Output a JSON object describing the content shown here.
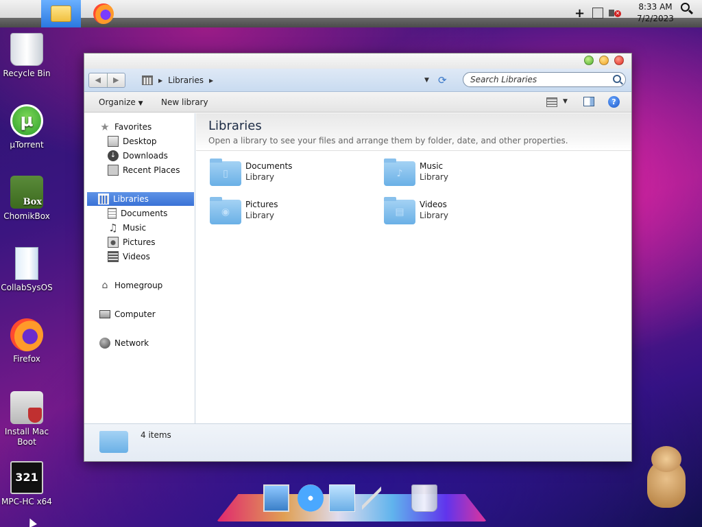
{
  "menubar": {
    "time": "8:33 AM",
    "date": "7/2/2023",
    "icons": [
      "apple-icon",
      "file-explorer-icon",
      "firefox-icon",
      "plus-icon",
      "network-icon",
      "volume-muted-icon",
      "search-icon"
    ]
  },
  "desktop": {
    "icons": [
      {
        "label": "Recycle Bin",
        "icon": "recycle-bin-icon"
      },
      {
        "label": "µTorrent",
        "icon": "utorrent-icon"
      },
      {
        "label": "ChomikBox",
        "icon": "chomikbox-icon"
      },
      {
        "label": "CollabSysOS",
        "icon": "collabsysos-icon"
      },
      {
        "label": "Firefox",
        "icon": "firefox-icon"
      },
      {
        "label": "Install Mac Boot",
        "icon": "install-mac-boot-icon"
      },
      {
        "label": "MPC-HC x64",
        "icon": "mpc-hc-icon"
      }
    ],
    "chomik_badge": "Box",
    "mpc_badge": "321"
  },
  "window": {
    "breadcrumb": "Libraries",
    "search_placeholder": "Search Libraries",
    "nav_back": "◀",
    "nav_forward": "▶",
    "toolbar": {
      "organize": "Organize",
      "new_library": "New library",
      "help": "?"
    },
    "sidebar": {
      "favorites": "Favorites",
      "favorites_items": [
        "Desktop",
        "Downloads",
        "Recent Places"
      ],
      "libraries": "Libraries",
      "libraries_items": [
        "Documents",
        "Music",
        "Pictures",
        "Videos"
      ],
      "homegroup": "Homegroup",
      "computer": "Computer",
      "network": "Network"
    },
    "main": {
      "title": "Libraries",
      "subtitle": "Open a library to see your files and arrange them by folder, date, and other properties.",
      "libraries": [
        {
          "name": "Documents",
          "kind": "Library",
          "glyph": "document-icon"
        },
        {
          "name": "Music",
          "kind": "Library",
          "glyph": "music-note-icon"
        },
        {
          "name": "Pictures",
          "kind": "Library",
          "glyph": "camera-icon"
        },
        {
          "name": "Videos",
          "kind": "Library",
          "glyph": "film-icon"
        }
      ]
    },
    "details": {
      "count": "4 items"
    }
  },
  "dock": {
    "items": [
      "preview-icon",
      "safari-icon",
      "mail-icon",
      "pen-icon",
      "trash-icon"
    ]
  },
  "colors": {
    "selection": "#3a72d6",
    "window_bg": "#ffffff",
    "folder": "#6ab0e6"
  }
}
